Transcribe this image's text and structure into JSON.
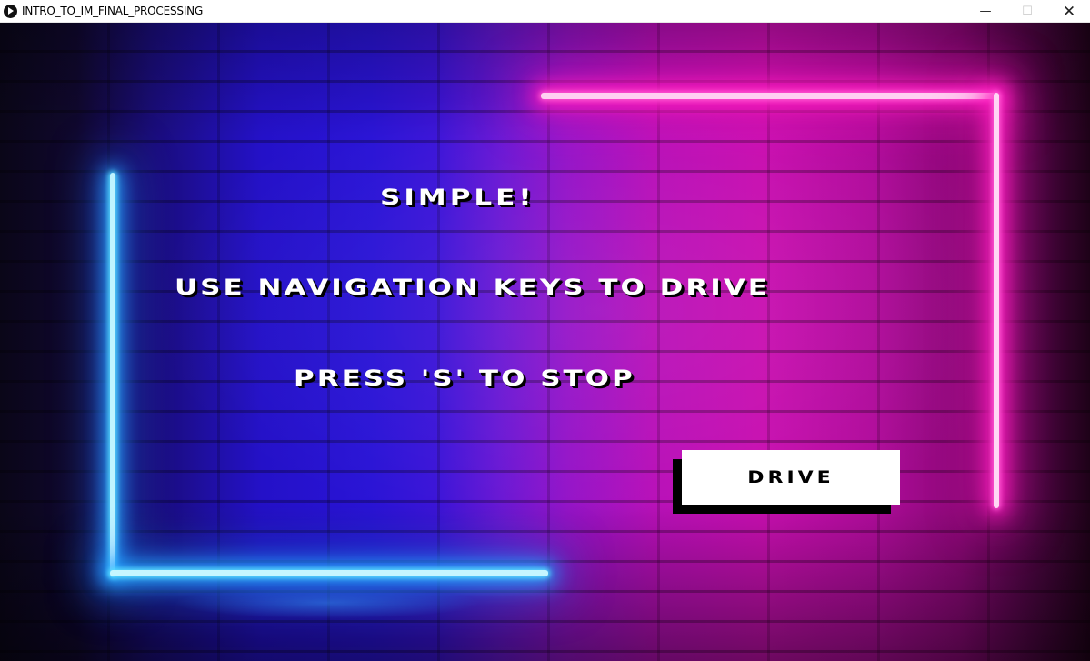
{
  "window": {
    "title": "INTRO_TO_IM_FINAL_PROCESSING",
    "icon": "processing-play-icon",
    "controls": {
      "minimize": "—",
      "maximize": "☐",
      "close": "✕"
    }
  },
  "instructions": {
    "line1": "SIMPLE!",
    "line2": "USE NAVIGATION KEYS TO DRIVE",
    "line3": "PRESS 'S' TO STOP"
  },
  "drive_button": {
    "label": "DRIVE"
  },
  "colors": {
    "neon_blue": "#55d8ff",
    "neon_pink": "#ff1ec0",
    "button_bg": "#ffffff",
    "text": "#ffffff"
  }
}
